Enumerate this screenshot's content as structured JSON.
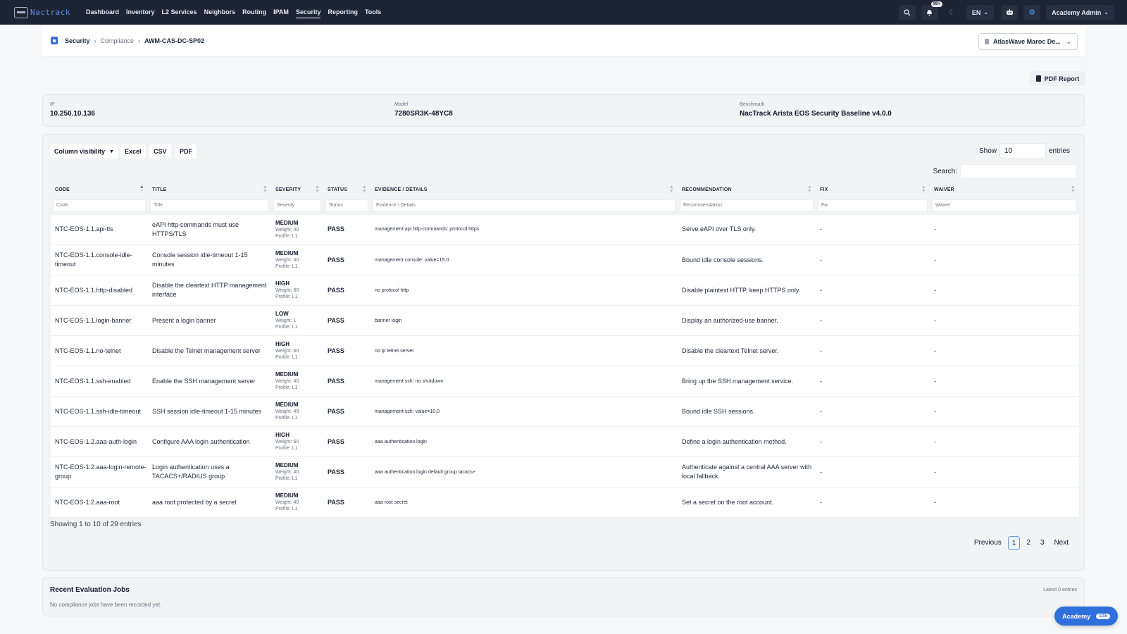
{
  "navbar": {
    "brand": "Nactrack",
    "links": [
      "Dashboard",
      "Inventory",
      "L2 Services",
      "Neighbors",
      "Routing",
      "IPAM",
      "Security",
      "Reporting",
      "Tools"
    ],
    "notification_badge": "99+",
    "language": "EN",
    "user": "Academy Admin"
  },
  "breadcrumb": {
    "section": "Security",
    "subsection": "Compliance",
    "current": "AWM-CAS-DC-SP02"
  },
  "tenant": {
    "selected": "AtlasWave Maroc De..."
  },
  "pdf_report_label": "PDF Report",
  "device": {
    "ip_label": "IP",
    "ip": "10.250.10.136",
    "model_label": "Model",
    "model": "7280SR3K-48YC8",
    "benchmark_label": "Benchmark",
    "benchmark": "NacTrack Arista EOS Security Baseline v4.0.0"
  },
  "toolbar": {
    "column_visibility": "Column visibility",
    "excel": "Excel",
    "csv": "CSV",
    "pdf": "PDF",
    "show_label": "Show",
    "show_value": "10",
    "entries_label": "entries",
    "search_label": "Search:"
  },
  "table": {
    "columns": [
      "CODE",
      "TITLE",
      "SEVERITY",
      "STATUS",
      "EVIDENCE / DETAILS",
      "RECOMMENDATION",
      "FIX",
      "WAIVER"
    ],
    "filter_placeholders": [
      "Code",
      "Title",
      "Severity",
      "Status",
      "Evidence / Details",
      "Recommendation",
      "Fix",
      "Waiver"
    ],
    "rows": [
      {
        "code": "NTC-EOS-1.1.api-tls",
        "title": "eAPI http-commands must use HTTPS/TLS",
        "severity": "MEDIUM",
        "weight": "Weight: 40",
        "profile": "Profile: L1",
        "status": "PASS",
        "evidence": "management api http-commands: protocol https",
        "recommendation": "Serve eAPI over TLS only.",
        "fix": "-",
        "waiver": "-"
      },
      {
        "code": "NTC-EOS-1.1.console-idle-timeout",
        "title": "Console session idle-timeout 1-15 minutes",
        "severity": "MEDIUM",
        "weight": "Weight: 40",
        "profile": "Profile: L1",
        "status": "PASS",
        "evidence": "management console: value=15.0",
        "recommendation": "Bound idle console sessions.",
        "fix": "-",
        "waiver": "-"
      },
      {
        "code": "NTC-EOS-1.1.http-disabled",
        "title": "Disable the cleartext HTTP management interface",
        "severity": "HIGH",
        "weight": "Weight: 60",
        "profile": "Profile: L1",
        "status": "PASS",
        "evidence": "no protocol http",
        "recommendation": "Disable plaintext HTTP, keep HTTPS only.",
        "fix": "-",
        "waiver": "-"
      },
      {
        "code": "NTC-EOS-1.1.login-banner",
        "title": "Present a login banner",
        "severity": "LOW",
        "weight": "Weight: 1",
        "profile": "Profile: L1",
        "status": "PASS",
        "evidence": "banner login",
        "recommendation": "Display an authorized-use banner.",
        "fix": "-",
        "waiver": "-"
      },
      {
        "code": "NTC-EOS-1.1.no-telnet",
        "title": "Disable the Telnet management server",
        "severity": "HIGH",
        "weight": "Weight: 60",
        "profile": "Profile: L1",
        "status": "PASS",
        "evidence": "no ip telnet server",
        "recommendation": "Disable the cleartext Telnet server.",
        "fix": "-",
        "waiver": "-"
      },
      {
        "code": "NTC-EOS-1.1.ssh-enabled",
        "title": "Enable the SSH management server",
        "severity": "MEDIUM",
        "weight": "Weight: 40",
        "profile": "Profile: L1",
        "status": "PASS",
        "evidence": "management ssh: no shutdown",
        "recommendation": "Bring up the SSH management service.",
        "fix": "-",
        "waiver": "-"
      },
      {
        "code": "NTC-EOS-1.1.ssh-idle-timeout",
        "title": "SSH session idle-timeout 1-15 minutes",
        "severity": "MEDIUM",
        "weight": "Weight: 40",
        "profile": "Profile: L1",
        "status": "PASS",
        "evidence": "management ssh: value=10.0",
        "recommendation": "Bound idle SSH sessions.",
        "fix": "-",
        "waiver": "-"
      },
      {
        "code": "NTC-EOS-1.2.aaa-auth-login",
        "title": "Configure AAA login authentication",
        "severity": "HIGH",
        "weight": "Weight: 60",
        "profile": "Profile: L1",
        "status": "PASS",
        "evidence": "aaa authentication login",
        "recommendation": "Define a login authentication method.",
        "fix": "-",
        "waiver": "-"
      },
      {
        "code": "NTC-EOS-1.2.aaa-login-remote-group",
        "title": "Login authentication uses a TACACS+/RADIUS group",
        "severity": "MEDIUM",
        "weight": "Weight: 40",
        "profile": "Profile: L1",
        "status": "PASS",
        "evidence": "aaa authentication login default group tacacs+",
        "recommendation": "Authenticate against a central AAA server with local fallback.",
        "fix": "-",
        "waiver": "-"
      },
      {
        "code": "NTC-EOS-1.2.aaa-root",
        "title": "aaa root protected by a secret",
        "severity": "MEDIUM",
        "weight": "Weight: 40",
        "profile": "Profile: L1",
        "status": "PASS",
        "evidence": "aaa root secret",
        "recommendation": "Set a secret on the root account.",
        "fix": "-",
        "waiver": "-"
      }
    ]
  },
  "pagination": {
    "summary": "Showing 1 to 10 of 29 entries",
    "previous": "Previous",
    "pages": [
      "1",
      "2",
      "3"
    ],
    "next": "Next"
  },
  "jobs": {
    "title": "Recent Evaluation Jobs",
    "meta": "Latest 0 entries",
    "empty": "No compliance jobs have been recorded yet."
  },
  "academy": {
    "label": "Academy",
    "count": "1/15"
  }
}
